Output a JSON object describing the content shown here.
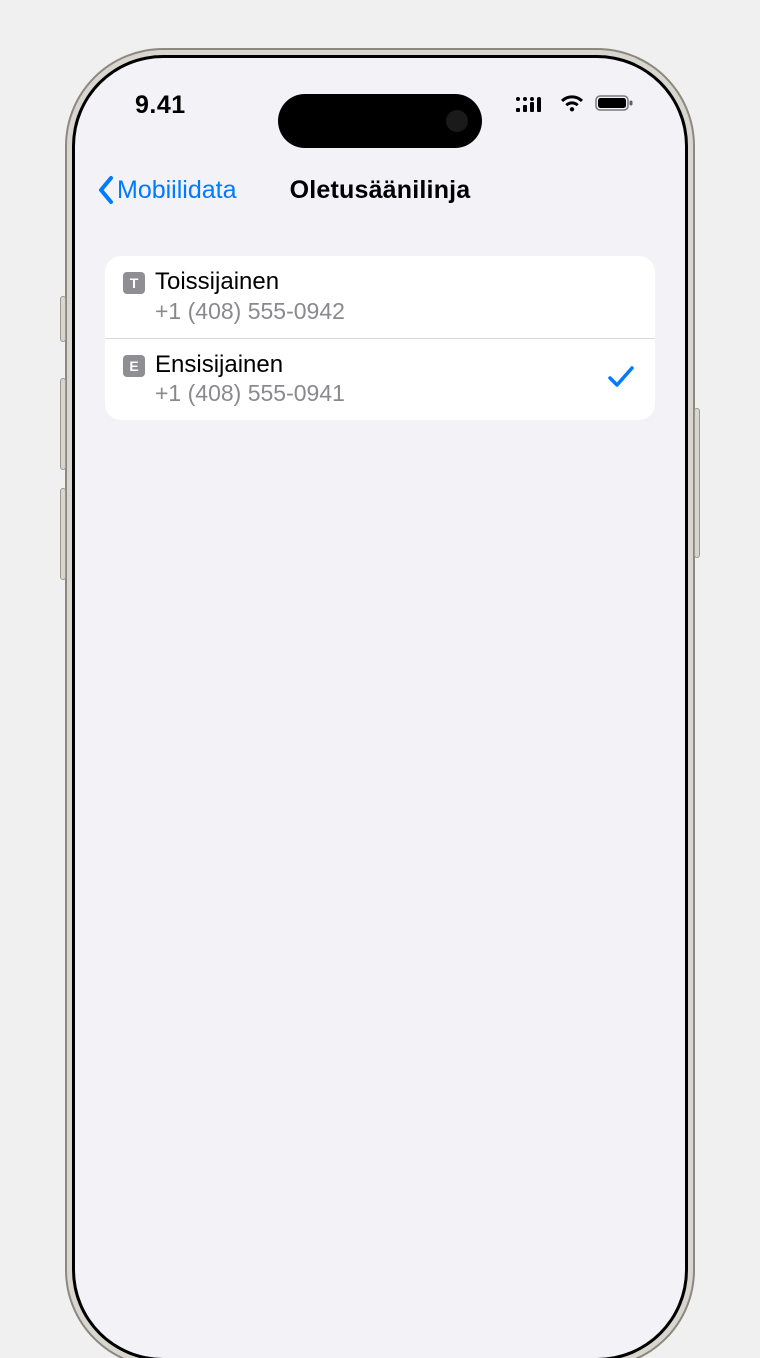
{
  "status": {
    "time": "9.41"
  },
  "nav": {
    "back_label": "Mobiilidata",
    "title": "Oletusäänilinja"
  },
  "lines": [
    {
      "badge": "T",
      "label": "Toissijainen",
      "number": "+1 (408) 555-0942",
      "selected": false
    },
    {
      "badge": "E",
      "label": "Ensisijainen",
      "number": "+1 (408) 555-0941",
      "selected": true
    }
  ]
}
